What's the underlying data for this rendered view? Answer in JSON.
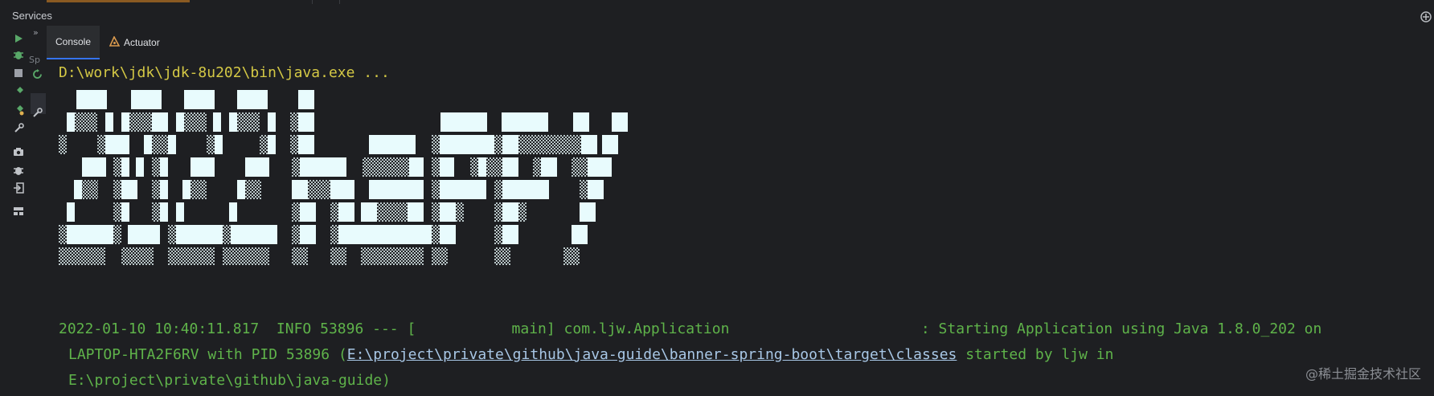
{
  "panel": {
    "title": "Services",
    "tree_label": "› ›",
    "tree_partial": "Sp"
  },
  "tabs": [
    {
      "label": "Console",
      "active": true
    },
    {
      "label": "Actuator",
      "active": false
    }
  ],
  "toolbar_icons": [
    "run-icon",
    "debug-icon",
    "stop-icon",
    "pin-icon",
    "pin-alt-icon",
    "wrench-icon",
    "camera-icon",
    "bug-icon",
    "login-icon",
    "layout-icon"
  ],
  "console": {
    "command": "D:\\work\\jdk\\jdk-8u202\\bin\\java.exe ...",
    "log_line1": "2022-01-10 10:40:11.817  INFO 53896 --- [           main] com.ljw.Application                      : Starting Application using Java 1.8.0_202 on",
    "log_line2_prefix": "LAPTOP-HTA2F6RV with PID 53896 (",
    "log_line2_link": "E:\\project\\private\\github\\java-guide\\banner-spring-boot\\target\\classes",
    "log_line2_suffix": " started by ljw in",
    "log_line3": "E:\\project\\private\\github\\java-guide)"
  },
  "colors": {
    "background": "#1e1f22",
    "command_text": "#d4c845",
    "log_text": "#5fb34a",
    "link_text": "#a8c7e6",
    "banner_fill": "#e8fbfd"
  },
  "watermark": "@稀土掘金技术社区"
}
